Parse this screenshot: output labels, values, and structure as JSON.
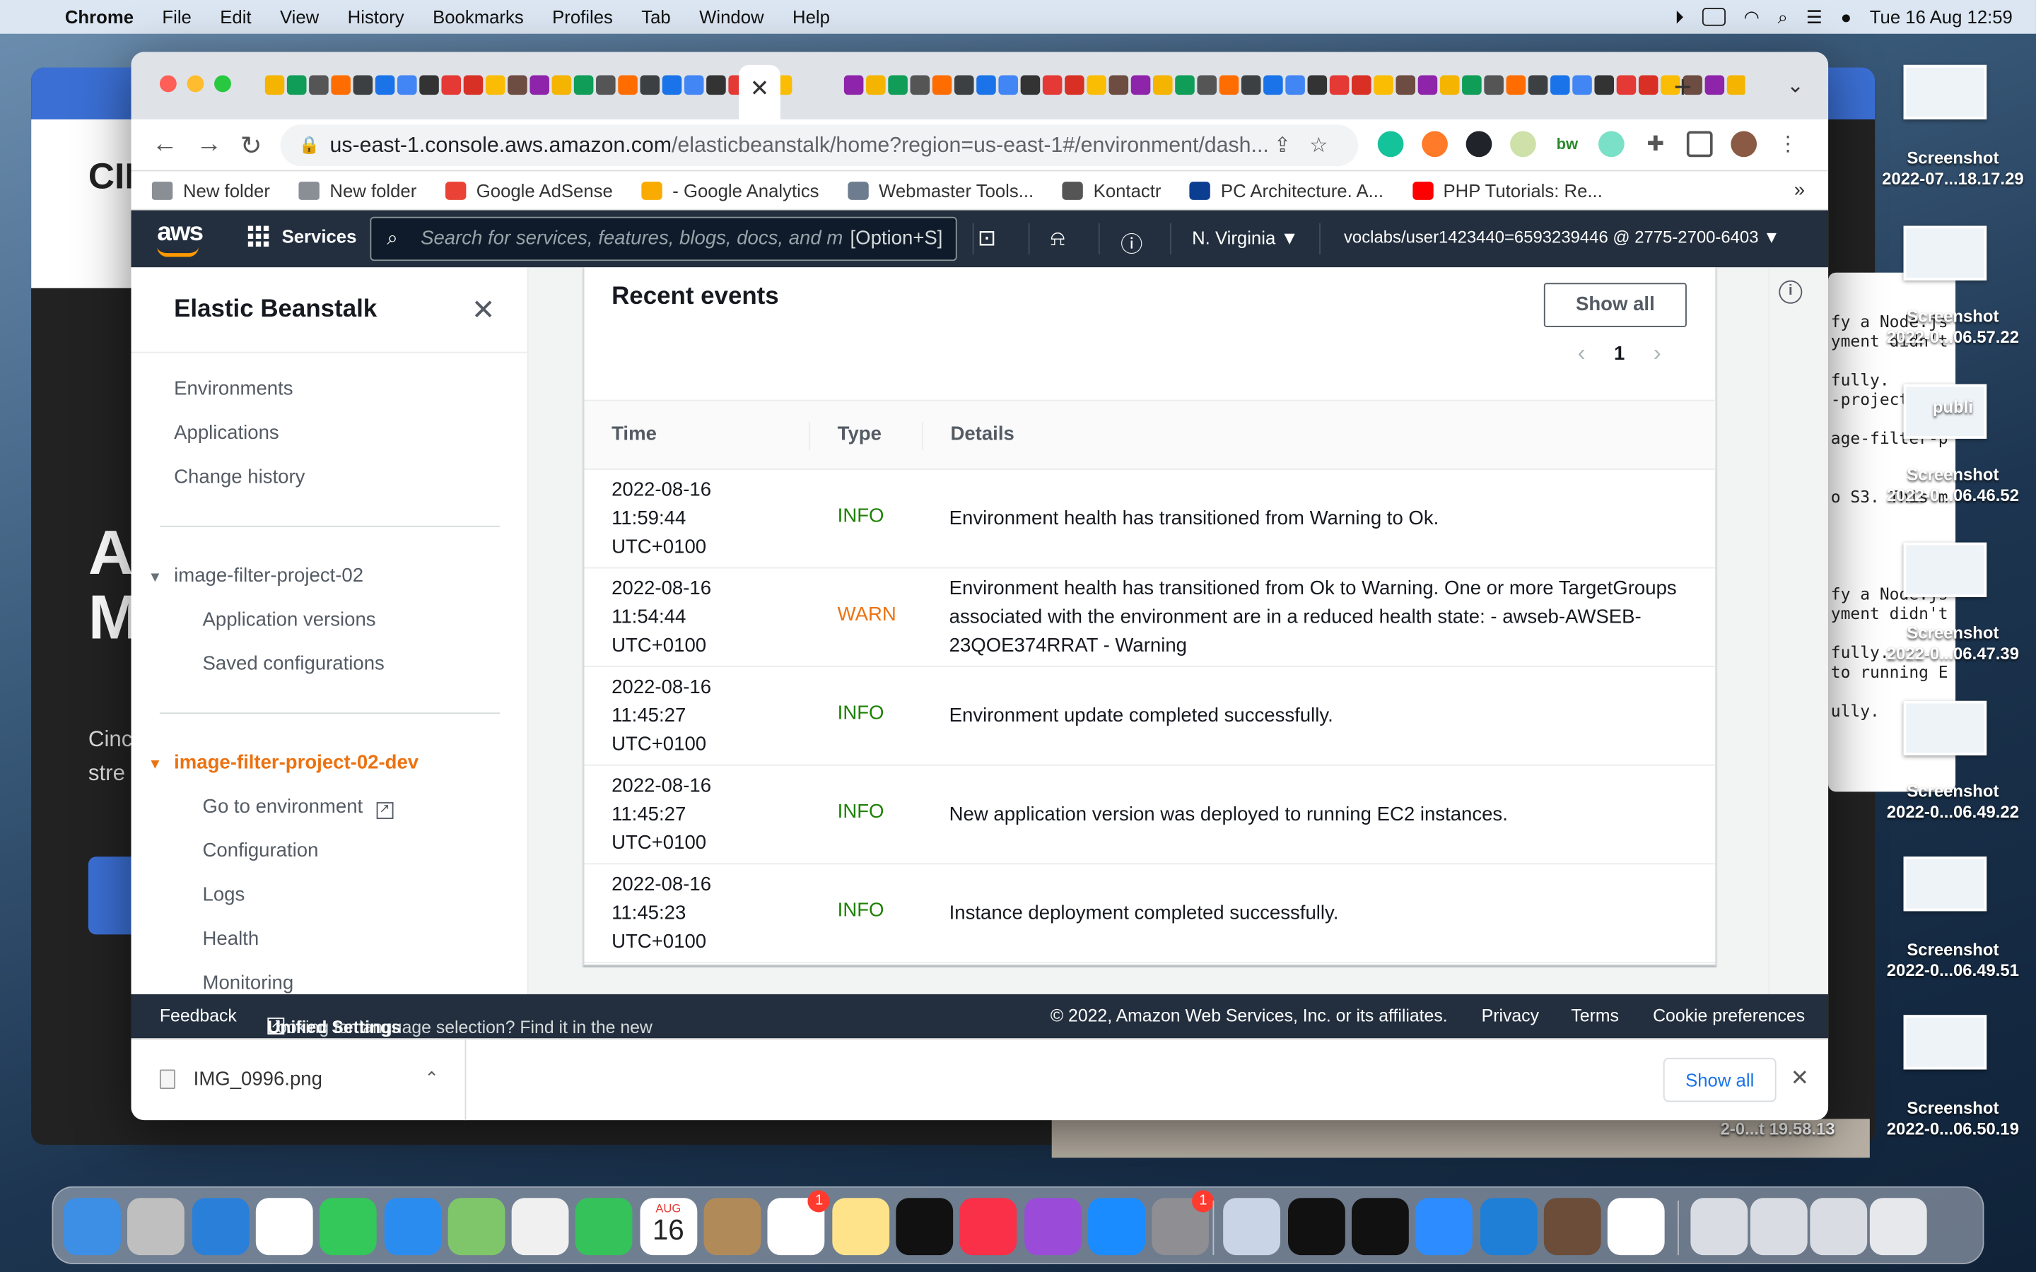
{
  "menubar": {
    "app": "Chrome",
    "items": [
      "File",
      "Edit",
      "View",
      "History",
      "Bookmarks",
      "Profiles",
      "Tab",
      "Window",
      "Help"
    ],
    "clock": "Tue 16 Aug  12:59"
  },
  "desktop": {
    "thumbs": [
      {
        "label1": "Screenshot",
        "label2": "2022-07...18.17.29"
      },
      {
        "label1": "Screenshot",
        "label2": "2022-0...06.57.22"
      },
      {
        "label1": "Screenshot",
        "label2": "publi"
      },
      {
        "label1": "Screenshot",
        "label2": "2022-0...06.46.52"
      },
      {
        "label1": "Screenshot",
        "label2": "2022-0...06.47.39"
      },
      {
        "label1": "Screenshot",
        "label2": "2022-0...06.49.22"
      },
      {
        "label1": "Screenshot",
        "label2": "2022-0...06.49.51"
      },
      {
        "label1": "Screenshot",
        "label2": "2022-0...06.50.19"
      }
    ],
    "extra_label": "2-0...t 19.58.13",
    "bg_text_big": "A\nM",
    "bg_text_small": "Cinc\nstre",
    "bg_logo": "CIN",
    "terminal_lines": "fy a Node.js\nyment didn't\n\nfully.\n-project-02-\n\nage-filter-p\n\n\no S3. This m\n\n\n\n\nfy a Node.js\nyment didn't\n\nfully.\nto running E\n\nully."
  },
  "browser": {
    "url_host": "us-east-1.console.aws.amazon.com",
    "url_path": "/elasticbeanstalk/home?region=us-east-1#/environment/dash...",
    "bookmarks": [
      {
        "label": "New folder",
        "icon": "folder-icon"
      },
      {
        "label": "New folder",
        "icon": "folder-icon"
      },
      {
        "label": "Google AdSense",
        "icon": "google-icon"
      },
      {
        "label": "- Google Analytics",
        "icon": "analytics-icon"
      },
      {
        "label": "Webmaster Tools...",
        "icon": "webmaster-icon"
      },
      {
        "label": "Kontactr",
        "icon": "globe-icon"
      },
      {
        "label": "PC Architecture. A...",
        "icon": "kg-icon"
      },
      {
        "label": "PHP Tutorials: Re...",
        "icon": "youtube-icon"
      }
    ],
    "bookmarks_more": "»"
  },
  "aws": {
    "logo": "aws",
    "services": "Services",
    "search_placeholder": "Search for services, features, blogs, docs, and m",
    "search_hint": "[Option+S]",
    "region": "N. Virginia ▼",
    "account": "voclabs/user1423440=6593239446 @ 2775-2700-6403 ▼"
  },
  "sidebar": {
    "title": "Elastic Beanstalk",
    "top_links": [
      "Environments",
      "Applications",
      "Change history"
    ],
    "app_name": "image-filter-project-02",
    "app_links": [
      "Application versions",
      "Saved configurations"
    ],
    "env_name": "image-filter-project-02-dev",
    "env_links": [
      "Go to environment",
      "Configuration",
      "Logs",
      "Health",
      "Monitoring"
    ]
  },
  "events": {
    "title": "Recent events",
    "show_all": "Show all",
    "page": "1",
    "columns": [
      "Time",
      "Type",
      "Details"
    ],
    "rows": [
      {
        "time": [
          "2022-08-16",
          "11:59:44",
          "UTC+0100"
        ],
        "type": "INFO",
        "details": "Environment health has transitioned from Warning to Ok."
      },
      {
        "time": [
          "2022-08-16",
          "11:54:44",
          "UTC+0100"
        ],
        "type": "WARN",
        "details": "Environment health has transitioned from Ok to Warning. One or more TargetGroups associated with the environment are in a reduced health state: - awseb-AWSEB-23QOE374RRAT - Warning"
      },
      {
        "time": [
          "2022-08-16",
          "11:45:27",
          "UTC+0100"
        ],
        "type": "INFO",
        "details": "Environment update completed successfully."
      },
      {
        "time": [
          "2022-08-16",
          "11:45:27",
          "UTC+0100"
        ],
        "type": "INFO",
        "details": "New application version was deployed to running EC2 instances."
      },
      {
        "time": [
          "2022-08-16",
          "11:45:23",
          "UTC+0100"
        ],
        "type": "INFO",
        "details": "Instance deployment completed successfully."
      }
    ]
  },
  "footer": {
    "feedback": "Feedback",
    "lang_text": "Looking for language selection? Find it in the new",
    "unified": "Unified Settings",
    "copyright": "© 2022, Amazon Web Services, Inc. or its affiliates.",
    "privacy": "Privacy",
    "terms": "Terms",
    "cookies": "Cookie preferences"
  },
  "downloads": {
    "file": "IMG_0996.png",
    "show_all": "Show all"
  },
  "dock": {
    "calendar_month": "AUG",
    "calendar_day": "16",
    "reminders_badge": "1",
    "settings_badge": "1",
    "apps": [
      "finder-icon",
      "launchpad-icon",
      "safari-icon",
      "chrome-icon",
      "messages-icon",
      "mail-icon",
      "maps-icon",
      "photos-icon",
      "facetime-icon",
      "calendar-icon",
      "contacts-icon",
      "reminders-icon",
      "notes-icon",
      "appletv-icon",
      "music-icon",
      "podcasts-icon",
      "appstore-icon",
      "settings-icon",
      "preview-icon",
      "terminal-icon",
      "activity-monitor-icon",
      "zoom-icon",
      "vscode-icon",
      "postgres-icon",
      "cinema-icon"
    ]
  },
  "colors": {
    "aws_nav": "#232f3e",
    "aws_orange": "#ec7211",
    "info_green": "#1d8102",
    "chrome_blue": "#1a73e8"
  }
}
